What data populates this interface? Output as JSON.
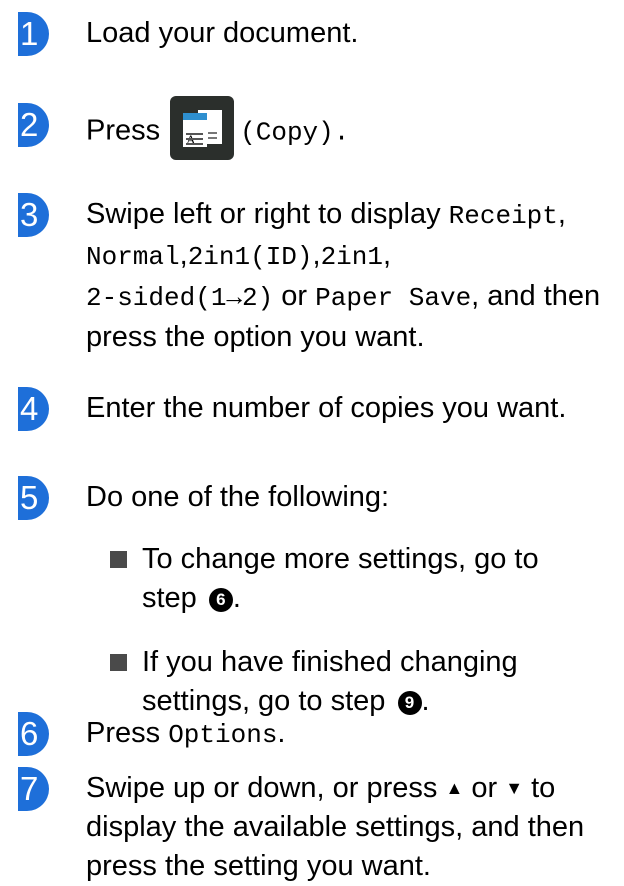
{
  "theme": {
    "badge_color": "#1e6fd9"
  },
  "steps": [
    {
      "number": "1",
      "text": "Load your document."
    },
    {
      "number": "2",
      "press_label": "Press",
      "icon": "copy-icon",
      "icon_letter": "A",
      "after_icon": "(Copy)."
    },
    {
      "number": "3",
      "t1": "Swipe left or right to display ",
      "m1": "Receipt",
      "t2": ",",
      "m2": "Normal",
      "t3": ",",
      "m3": "2in1(ID)",
      "t4": ",",
      "m4": "2in1",
      "t5": ",",
      "m5": "2-sided(1→2)",
      "t6": " or ",
      "m6": "Paper Save",
      "t7": ", and then press the option you want."
    },
    {
      "number": "4",
      "text": "Enter the number of copies you want."
    },
    {
      "number": "5",
      "text": "Do one of the following:",
      "bullets": [
        {
          "line1": "To change more settings, go to",
          "line2": "step",
          "ref": "6",
          "end": "."
        },
        {
          "line1": "If you have finished changing",
          "line2": "settings, go to step",
          "ref": "9",
          "end": "."
        }
      ]
    },
    {
      "number": "6",
      "text": "Press",
      "mono": "Options",
      "end": "."
    },
    {
      "number": "7",
      "t1": "Swipe up or down, or press",
      "up": "▲",
      "t2": "or",
      "down": "▼",
      "t3": "to display the available settings, and then press the setting you want."
    }
  ]
}
